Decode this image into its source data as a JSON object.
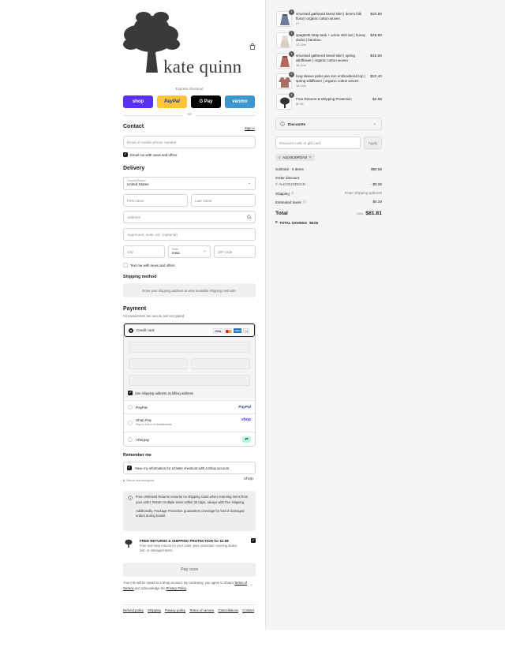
{
  "brand": {
    "name": "kate quinn"
  },
  "express": {
    "label": "Express checkout",
    "or": "OR",
    "buttons": [
      {
        "label": "shop",
        "color": "#5a31f4"
      },
      {
        "label": "PayPal",
        "color": "#ffc439"
      },
      {
        "label": "G Pay",
        "color": "#000000"
      },
      {
        "label": "venmo",
        "color": "#3d95ce"
      }
    ]
  },
  "contact": {
    "heading": "Contact",
    "signin": "Sign in",
    "email_placeholder": "Email or mobile phone number",
    "email_news": "Email me with news and offers"
  },
  "delivery": {
    "heading": "Delivery",
    "country_label": "Country/Region",
    "country_value": "United States",
    "first_name": "First name",
    "last_name": "Last name",
    "address": "Address",
    "apartment": "Apartment, suite, etc. (optional)",
    "city": "City",
    "state_label": "State",
    "state_value": "Iowa",
    "zip": "ZIP code",
    "text_news": "Text me with news and offers"
  },
  "shipping": {
    "heading": "Shipping method",
    "note": "Enter your shipping address to view available shipping methods."
  },
  "payment": {
    "heading": "Payment",
    "secure": "All transactions are secure and encrypted.",
    "credit_card": "Credit card",
    "card_brands": [
      "VISA",
      "MC",
      "AMEX",
      "+4"
    ],
    "billing_same": "Use shipping address as billing address",
    "paypal": "PayPal",
    "paypal_logo": "PayPal",
    "shop_pay": "Shop Pay",
    "shop_pay_sub": "Pay in full or in installments",
    "shop_logo": "shop",
    "afterpay": "Afterpay"
  },
  "remember": {
    "heading": "Remember me",
    "save_info": "Save my information for a faster checkout with a Shop account",
    "secure": "Secure and encrypted",
    "shop_logo": "shop"
  },
  "protection": {
    "info_1": "Free Unlimited Returns ensures no shipping costs when returning items from your order. Return multiple times within 30 days, always with free shipping.",
    "info_2": "Additionally, Package Protection guarantees coverage for lost or damaged orders during transit.",
    "title": "FREE RETURNS & SHIPPING PROTECTION for $2.98",
    "desc": "Free and easy returns for your order, plus protection covering stolen, lost, or damaged items."
  },
  "pay_now": "Pay now",
  "legal": {
    "text_1": "Your info will be saved to a Shop account. By continuing, you agree to Shop's",
    "terms": "Terms of Service",
    "and": "and acknowledge the",
    "privacy": "Privacy Policy",
    "end": "."
  },
  "footer_links": [
    "Refund policy",
    "Shipping",
    "Privacy policy",
    "Terms of service",
    "Cancellations",
    "Contact"
  ],
  "cart": {
    "items": [
      {
        "qty": "1",
        "name": "smocked gathered tiered skirt | denim folk floral | organic cotton woven",
        "variant": "2T",
        "price": "$20.80"
      },
      {
        "qty": "1",
        "name": "spaghetti strap tank + a-line skirt set | honey ducks | bamboo",
        "variant": "12-18m",
        "price": "$28.80"
      },
      {
        "qty": "1",
        "name": "smocked gathered tiered skirt | spring wildflower | organic cotton woven",
        "variant": "18-24m",
        "price": "$15.60"
      },
      {
        "qty": "1",
        "name": "long sleeve peter pan sun embroidered top | spring wildflower | organic cotton woven",
        "variant": "18-24m",
        "price": "$22.40"
      },
      {
        "qty": "1",
        "name": "Free Returns & Shipping Protection",
        "variant": "$2.98",
        "price": "$2.98"
      }
    ],
    "discounts_label": "Discounts",
    "discount_placeholder": "Discount code or gift card",
    "apply": "Apply",
    "code_tag": "ALEXBJORDAN",
    "subtotal_label": "Subtotal · 5 items",
    "subtotal_value": "$90.58",
    "order_discount": "Order discount",
    "discount_code": "ALEXBJORDAN",
    "discount_value": "- $9.05",
    "shipping_label": "Shipping",
    "shipping_value": "Enter shipping address",
    "taxes_label": "Estimated taxes",
    "taxes_value": "$0.28",
    "total_label": "Total",
    "currency": "USD",
    "total_value": "$81.81",
    "savings_label": "TOTAL SAVINGS",
    "savings_value": "$9.05"
  }
}
